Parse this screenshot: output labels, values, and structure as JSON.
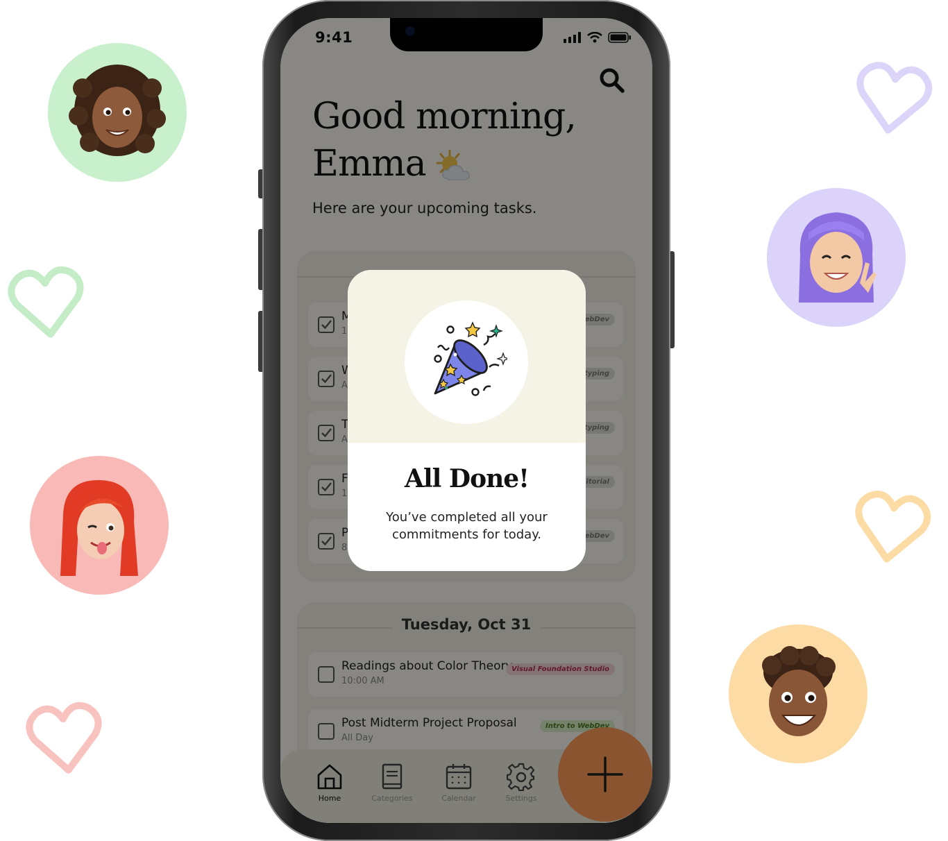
{
  "status_bar": {
    "time": "9:41"
  },
  "header": {
    "greeting_line1": "Good morning,",
    "greeting_line2": "Emma",
    "subtitle": "Here are your upcoming tasks."
  },
  "today_tasks": [
    {
      "title": "M",
      "time": "1",
      "tag": "WebDev",
      "done": true
    },
    {
      "title": "W",
      "time": "A",
      "tag": "otyping",
      "done": true
    },
    {
      "title": "T",
      "time": "A",
      "tag": "otyping",
      "done": true
    },
    {
      "title": "F",
      "time": "1",
      "tag": "ditorial",
      "done": true
    },
    {
      "title": "P",
      "time": "8",
      "tag": "WebDev",
      "done": true
    }
  ],
  "tuesday": {
    "date_label": "Tuesday, Oct 31",
    "tasks": [
      {
        "title": "Readings about Color Theory",
        "time": "10:00 AM",
        "tag": "Visual Foundation Studio",
        "tag_color": "#f6d6dc",
        "done": false
      },
      {
        "title": "Post Midterm Project Proposal",
        "time": "All Day",
        "tag": "Intro to WebDev",
        "tag_color": "#d9efc4",
        "done": false
      }
    ]
  },
  "nav": {
    "items": [
      {
        "label": "Home",
        "icon": "home-icon",
        "active": true
      },
      {
        "label": "Categories",
        "icon": "book-icon",
        "active": false
      },
      {
        "label": "Calendar",
        "icon": "calendar-icon",
        "active": false
      },
      {
        "label": "Settings",
        "icon": "gear-icon",
        "active": false
      }
    ],
    "fab_icon": "plus-icon"
  },
  "modal": {
    "icon": "party-popper-icon",
    "title": "All Done!",
    "message": "You’ve completed all your commitments for today."
  },
  "colors": {
    "fab": "#8a5430",
    "screen_bg": "#fbfaf4",
    "overlay": "rgba(0,0,0,0.46)",
    "avatar_green": "#c8f0cc",
    "avatar_purple": "#dcd3fb",
    "avatar_pink": "#f9b9b6",
    "avatar_orange": "#fddba4"
  }
}
